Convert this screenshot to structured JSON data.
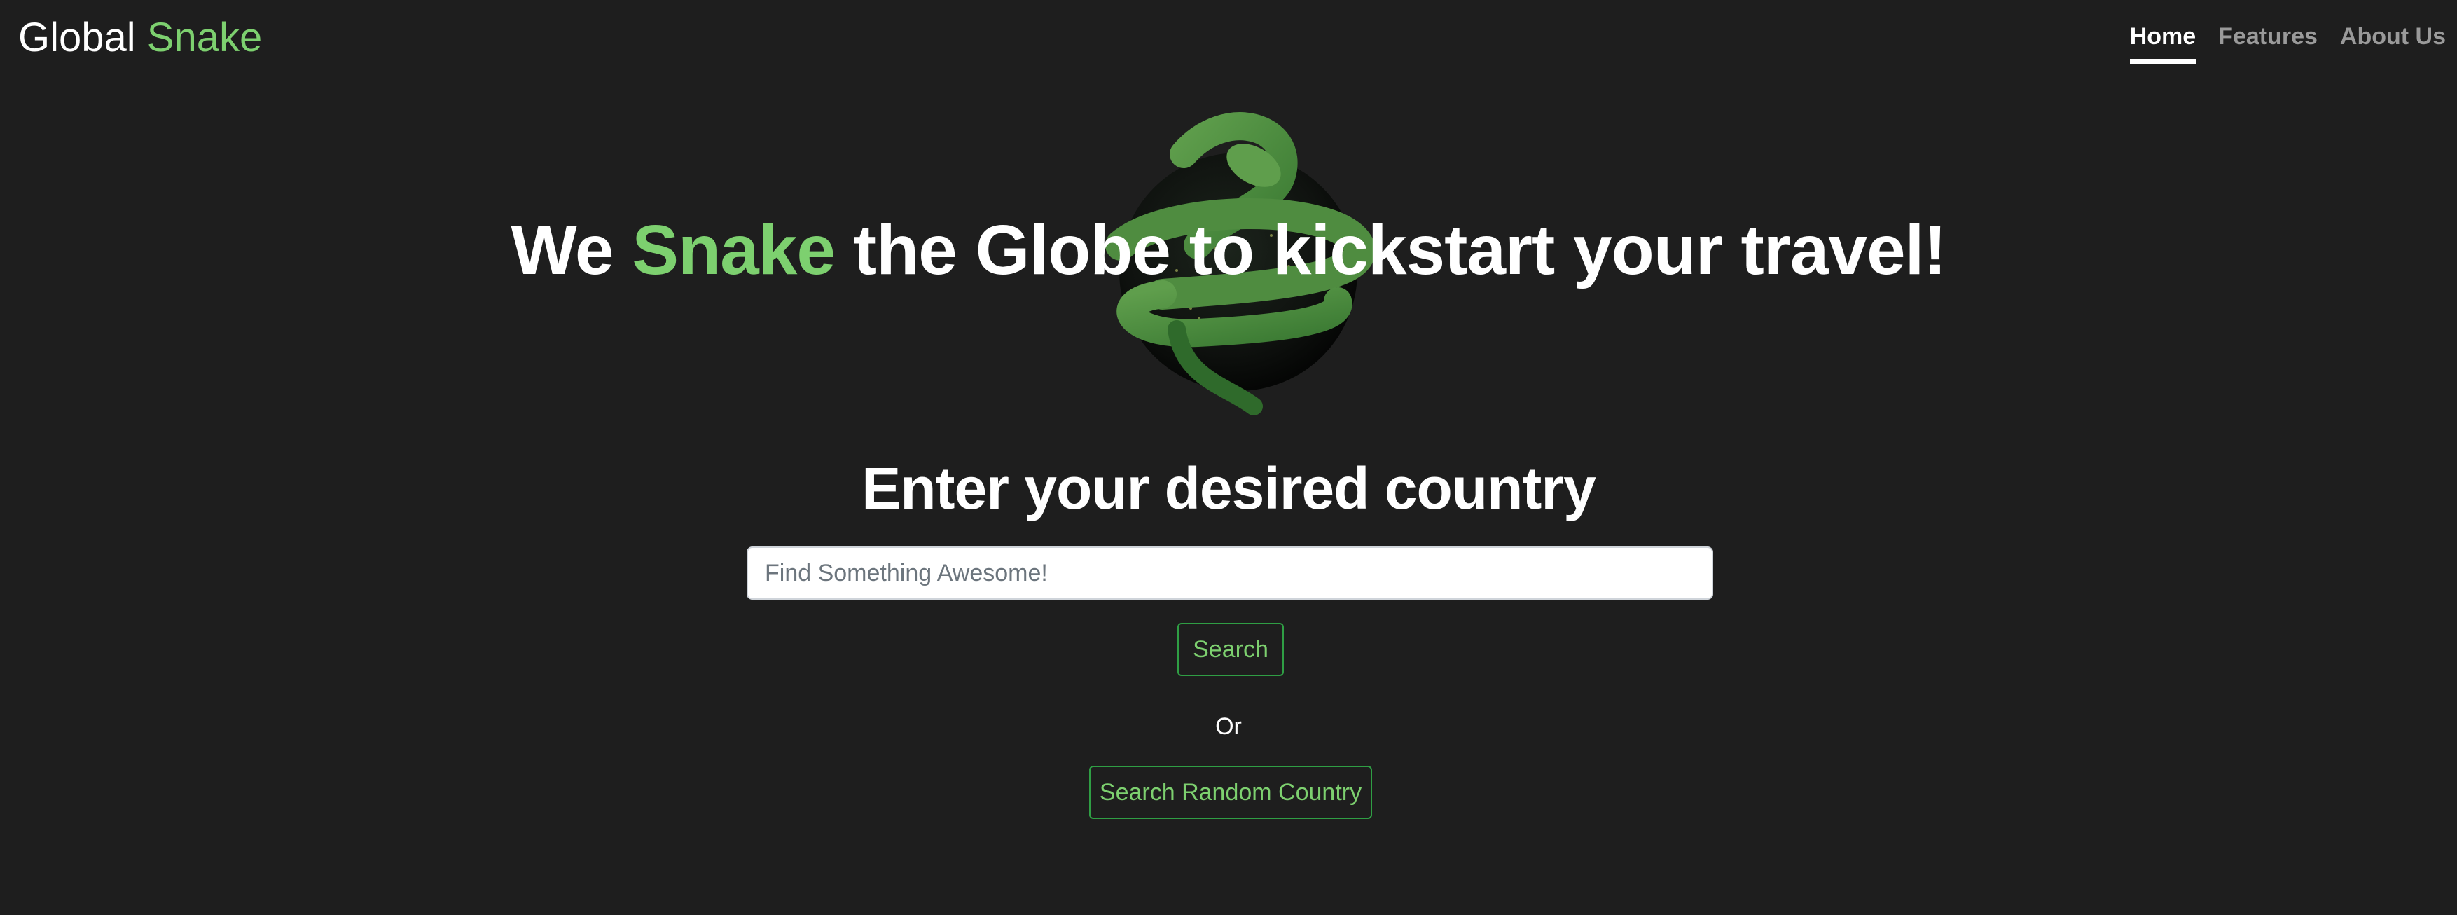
{
  "header": {
    "brand_primary": "Global",
    "brand_accent": "Snake"
  },
  "nav": {
    "items": [
      {
        "label": "Home",
        "active": true
      },
      {
        "label": "Features",
        "active": false
      },
      {
        "label": "About Us",
        "active": false
      }
    ]
  },
  "hero": {
    "title_before": "We",
    "title_accent": "Snake",
    "title_after": "the Globe to kickstart your travel!"
  },
  "search": {
    "heading": "Enter your desired country",
    "placeholder": "Find Something Awesome!",
    "value": "",
    "search_button": "Search",
    "or_text": "Or",
    "random_button": "Search Random Country"
  },
  "colors": {
    "background": "#1e1e1e",
    "accent_green": "#7dd06f",
    "button_border": "#2f9e44",
    "nav_inactive": "#9a9a9a"
  },
  "icons": {
    "hero": "snake-globe-logo"
  }
}
